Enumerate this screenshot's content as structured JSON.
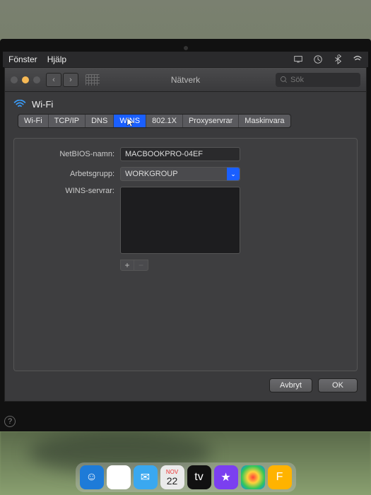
{
  "menubar": {
    "items": [
      "Fönster",
      "Hjälp"
    ]
  },
  "window": {
    "title": "Nätverk",
    "search_placeholder": "Sök"
  },
  "section": {
    "title": "Wi-Fi"
  },
  "tabs": [
    "Wi-Fi",
    "TCP/IP",
    "DNS",
    "WINS",
    "802.1X",
    "Proxyservrar",
    "Maskinvara"
  ],
  "active_tab_index": 3,
  "form": {
    "netbios_label": "NetBIOS-namn:",
    "netbios_value": "MACBOOKPRO-04EF",
    "workgroup_label": "Arbetsgrupp:",
    "workgroup_value": "WORKGROUP",
    "wins_label": "WINS-servrar:"
  },
  "buttons": {
    "cancel": "Avbryt",
    "ok": "OK",
    "add": "+",
    "remove": "−",
    "help": "?"
  },
  "dock_date": {
    "month": "NOV",
    "day": "22"
  }
}
